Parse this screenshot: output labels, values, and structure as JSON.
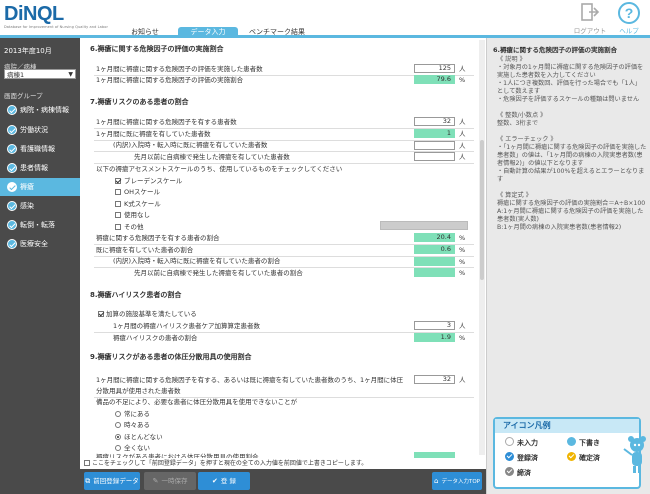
{
  "header": {
    "logo": "DiNQL",
    "logo_sub": "Database for Improvement of Nursing Quality and Labor",
    "tabs": [
      "お知らせ",
      "データ入力",
      "ベンチマーク結果"
    ],
    "active_tab": "データ入力",
    "logout_label": "ログアウト",
    "help_label": "ヘルプ",
    "accent": "#5bb8e0"
  },
  "sidebar": {
    "fiscal_year": "2013年度10月",
    "ward_label": "病院／病棟",
    "ward_value": "病棟1",
    "group_label": "画面グループ",
    "items": [
      {
        "label": "病院・病棟情報"
      },
      {
        "label": "労働状況"
      },
      {
        "label": "看護職情報"
      },
      {
        "label": "患者情報"
      },
      {
        "label": "褥瘡"
      },
      {
        "label": "感染"
      },
      {
        "label": "転倒・転落"
      },
      {
        "label": "医療安全"
      }
    ],
    "active_item": "褥瘡"
  },
  "sections": {
    "s6": {
      "title": "6.褥瘡に関する危険因子の評価の実施割合",
      "rows": [
        {
          "label": "1ヶ月間に褥瘡に関する危険因子の評価を実施した患者数",
          "value": "125",
          "unit": "人"
        },
        {
          "label": "1ヶ月間に褥瘡に関する危険因子の評価の実施割合",
          "value": "79.6",
          "unit": "%"
        }
      ]
    },
    "s7": {
      "title": "7.褥瘡リスクのある患者の割合",
      "rows": [
        {
          "label": "1ヶ月間に褥瘡に関する危険因子を有する患者数",
          "value": "32",
          "unit": "人"
        },
        {
          "label": "1ヶ月間に既に褥瘡を有していた患者数",
          "value": "1",
          "unit": "人"
        },
        {
          "label": "(内訳)入院時・転入時に既に褥瘡を有していた患者数",
          "value": "",
          "unit": "人"
        },
        {
          "label": "先月以前に自病棟で発生した褥瘡を有していた患者数",
          "value": "",
          "unit": "人"
        }
      ],
      "scale_question": "以下の褥瘡アセスメントスケールのうち、使用しているものをチェックしてください",
      "scales": [
        {
          "label": "ブレーデンスケール",
          "checked": true
        },
        {
          "label": "OHスケール",
          "checked": false
        },
        {
          "label": "K式スケール",
          "checked": false
        },
        {
          "label": "使用なし",
          "checked": false
        },
        {
          "label": "その他",
          "checked": false
        }
      ],
      "ratio_rows": [
        {
          "label": "褥瘡に関する危険因子を有する患者の割合",
          "value": "20.4",
          "unit": "%"
        },
        {
          "label": "既に褥瘡を有していた患者の割合",
          "value": "0.6",
          "unit": "%"
        },
        {
          "label": "(内訳)入院時・転入時に既に褥瘡を有していた患者の割合",
          "value": "",
          "unit": "%"
        },
        {
          "label": "先月以前に自病棟で発生した褥瘡を有していた患者の割合",
          "value": "",
          "unit": "%"
        }
      ]
    },
    "s8": {
      "title": "8.褥瘡ハイリスク患者の割合",
      "checkbox_label": "加算の施設基準を満たしている",
      "rows": [
        {
          "label": "1ヶ月間の褥瘡ハイリスク患者ケア加算算定患者数",
          "value": "3",
          "unit": "人"
        },
        {
          "label": "褥瘡ハイリスクの患者の割合",
          "value": "1.9",
          "unit": "%"
        }
      ]
    },
    "s9": {
      "title": "9.褥瘡リスクがある患者の体圧分散用具の使用割合",
      "q1_line1": "1ヶ月間に褥瘡に関する危険因子を有する、あるいは既に褥瘡を有していた患者数のうち、1ヶ月間に体圧",
      "q1_line2": "分散用具が使用された患者数",
      "q1_value": "32",
      "q1_unit": "人",
      "q2": "備品の不足により、必要な患者に体圧分散用具を使用できないことが",
      "options": [
        {
          "label": "常にある",
          "checked": false
        },
        {
          "label": "時々ある",
          "checked": false
        },
        {
          "label": "ほとんどない",
          "checked": true
        },
        {
          "label": "全くない",
          "checked": false
        }
      ],
      "last_label": "褥瘡リスクがある患者における体圧分散用具の使用割合",
      "last_value": "97.0",
      "last_unit": "%"
    }
  },
  "footer": {
    "note": "ここをチェックして「前回登録データ」を押すと現在の全ての入力値を前回値で上書きコピーします。",
    "btn_prev": "前回登録データ",
    "btn_temp": "一時保存",
    "btn_register": "登 録",
    "btn_top": "データ入力TOP"
  },
  "right_panel": {
    "title": "6.褥瘡に関する危険因子の評価の実施割合",
    "body": "《 説明 》\n・対象月の1ヶ月間に褥瘡に関する危険因子の評価を実施した患者数を入力してください\n・1人につき複数回、評価を行った場合でも「1人」として数えます\n・危険因子を評価するスケールの種類は問いません\n\n《 整数/小数点 》\n整数、3桁まで\n\n《 エラーチェック 》\n・「1ヶ月間に褥瘡に関する危険因子の評価を実施した患者数」の値は、「1ヶ月間の病棟の入院実患者数(患者情報2)」の値以下となります\n・自動計算の結果が100%を超えるとエラーとなります\n\n《 算定式 》\n褥瘡に関する危険因子の評価の実施割合＝A÷B×100\nA:1ヶ月間に褥瘡に関する危険因子の評価を実施した患者数(実人数)\nB:1ヶ月間の病棟の入院実患者数(患者情報2)",
    "legend_title": "アイコン凡例",
    "legend": [
      {
        "label": "未入力",
        "color": "#ffffff"
      },
      {
        "label": "下書き",
        "color": "#5bb8e0"
      },
      {
        "label": "登録済",
        "color": "#2e8ed6"
      },
      {
        "label": "確定済",
        "color": "#f0b400"
      },
      {
        "label": "締済",
        "color": "#888888"
      }
    ]
  }
}
